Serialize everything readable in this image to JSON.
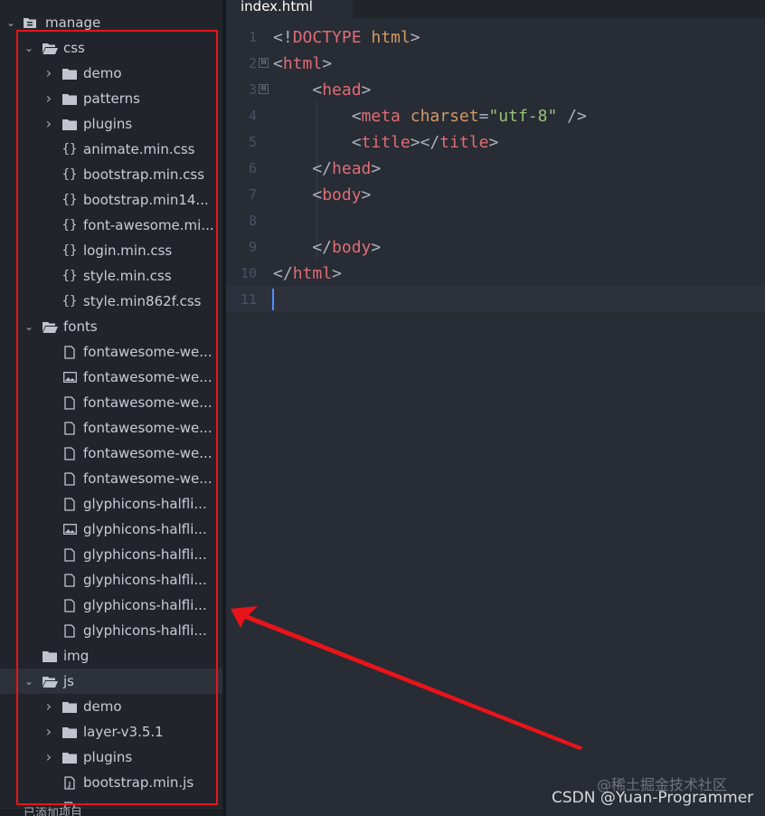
{
  "sidebar": {
    "root": {
      "label": "manage",
      "icon": "archive-folder-icon"
    },
    "rows": [
      {
        "label": "css",
        "type": "folder",
        "state": "open",
        "depth": 1
      },
      {
        "label": "demo",
        "type": "folder",
        "state": "closed",
        "depth": 2
      },
      {
        "label": "patterns",
        "type": "folder",
        "state": "closed",
        "depth": 2
      },
      {
        "label": "plugins",
        "type": "folder",
        "state": "closed",
        "depth": 2
      },
      {
        "label": "animate.min.css",
        "type": "css",
        "depth": 2
      },
      {
        "label": "bootstrap.min.css",
        "type": "css",
        "depth": 2
      },
      {
        "label": "bootstrap.min14...",
        "type": "css",
        "depth": 2
      },
      {
        "label": "font-awesome.mi...",
        "type": "css",
        "depth": 2
      },
      {
        "label": "login.min.css",
        "type": "css",
        "depth": 2
      },
      {
        "label": "style.min.css",
        "type": "css",
        "depth": 2
      },
      {
        "label": "style.min862f.css",
        "type": "css",
        "depth": 2
      },
      {
        "label": "fonts",
        "type": "folder",
        "state": "open",
        "depth": 1
      },
      {
        "label": "fontawesome-we...",
        "type": "file",
        "depth": 2
      },
      {
        "label": "fontawesome-we...",
        "type": "image",
        "depth": 2
      },
      {
        "label": "fontawesome-we...",
        "type": "file",
        "depth": 2
      },
      {
        "label": "fontawesome-we...",
        "type": "file",
        "depth": 2
      },
      {
        "label": "fontawesome-we...",
        "type": "file",
        "depth": 2
      },
      {
        "label": "fontawesome-we...",
        "type": "file",
        "depth": 2
      },
      {
        "label": "glyphicons-halfli...",
        "type": "file",
        "depth": 2
      },
      {
        "label": "glyphicons-halfli...",
        "type": "image",
        "depth": 2
      },
      {
        "label": "glyphicons-halfli...",
        "type": "file",
        "depth": 2
      },
      {
        "label": "glyphicons-halfli...",
        "type": "file",
        "depth": 2
      },
      {
        "label": "glyphicons-halfli...",
        "type": "file",
        "depth": 2
      },
      {
        "label": "glyphicons-halfli...",
        "type": "file",
        "depth": 2
      },
      {
        "label": "img",
        "type": "folder",
        "state": "empty",
        "depth": 1
      },
      {
        "label": "js",
        "type": "folder",
        "state": "open",
        "depth": 1,
        "selected": true
      },
      {
        "label": "demo",
        "type": "folder",
        "state": "closed",
        "depth": 2
      },
      {
        "label": "layer-v3.5.1",
        "type": "folder",
        "state": "closed",
        "depth": 2
      },
      {
        "label": "plugins",
        "type": "folder",
        "state": "closed",
        "depth": 2
      },
      {
        "label": "bootstrap.min.js",
        "type": "js",
        "depth": 2
      },
      {
        "label": "",
        "type": "js",
        "depth": 2
      }
    ],
    "bottom_label": "已添加项目"
  },
  "editor": {
    "tab": {
      "label": "index.html"
    },
    "line_numbers": [
      "1",
      "2",
      "3",
      "4",
      "5",
      "6",
      "7",
      "8",
      "9",
      "10",
      "11"
    ],
    "fold_markers": [
      "⊟",
      "⊟"
    ],
    "lines": [
      {
        "tokens": [
          {
            "t": "<!",
            "c": "punct"
          },
          {
            "t": "DOCTYPE",
            "c": "tag"
          },
          {
            "t": " html",
            "c": "attr"
          },
          {
            "t": ">",
            "c": "punct"
          }
        ]
      },
      {
        "tokens": [
          {
            "t": "<",
            "c": "punct"
          },
          {
            "t": "html",
            "c": "tag"
          },
          {
            "t": ">",
            "c": "punct"
          }
        ]
      },
      {
        "tokens": [
          {
            "t": "    <",
            "c": "punct"
          },
          {
            "t": "head",
            "c": "tag"
          },
          {
            "t": ">",
            "c": "punct"
          }
        ]
      },
      {
        "tokens": [
          {
            "t": "        <",
            "c": "punct"
          },
          {
            "t": "meta",
            "c": "tag"
          },
          {
            "t": " charset",
            "c": "attr"
          },
          {
            "t": "=",
            "c": "punct"
          },
          {
            "t": "\"utf-8\"",
            "c": "str"
          },
          {
            "t": " />",
            "c": "punct"
          }
        ]
      },
      {
        "tokens": [
          {
            "t": "        <",
            "c": "punct"
          },
          {
            "t": "title",
            "c": "tag"
          },
          {
            "t": "></",
            "c": "punct"
          },
          {
            "t": "title",
            "c": "tag"
          },
          {
            "t": ">",
            "c": "punct"
          }
        ]
      },
      {
        "tokens": [
          {
            "t": "    </",
            "c": "punct"
          },
          {
            "t": "head",
            "c": "tag"
          },
          {
            "t": ">",
            "c": "punct"
          }
        ]
      },
      {
        "tokens": [
          {
            "t": "    <",
            "c": "punct"
          },
          {
            "t": "body",
            "c": "tag"
          },
          {
            "t": ">",
            "c": "punct"
          }
        ]
      },
      {
        "tokens": []
      },
      {
        "tokens": [
          {
            "t": "    </",
            "c": "punct"
          },
          {
            "t": "body",
            "c": "tag"
          },
          {
            "t": ">",
            "c": "punct"
          }
        ]
      },
      {
        "tokens": [
          {
            "t": "</",
            "c": "punct"
          },
          {
            "t": "html",
            "c": "tag"
          },
          {
            "t": ">",
            "c": "punct"
          }
        ]
      },
      {
        "tokens": []
      }
    ]
  },
  "annotation": {
    "color": "#e8141a"
  },
  "watermarks": {
    "site": "@稀土掘金技术社区",
    "author": "CSDN @Yuan-Programmer"
  }
}
